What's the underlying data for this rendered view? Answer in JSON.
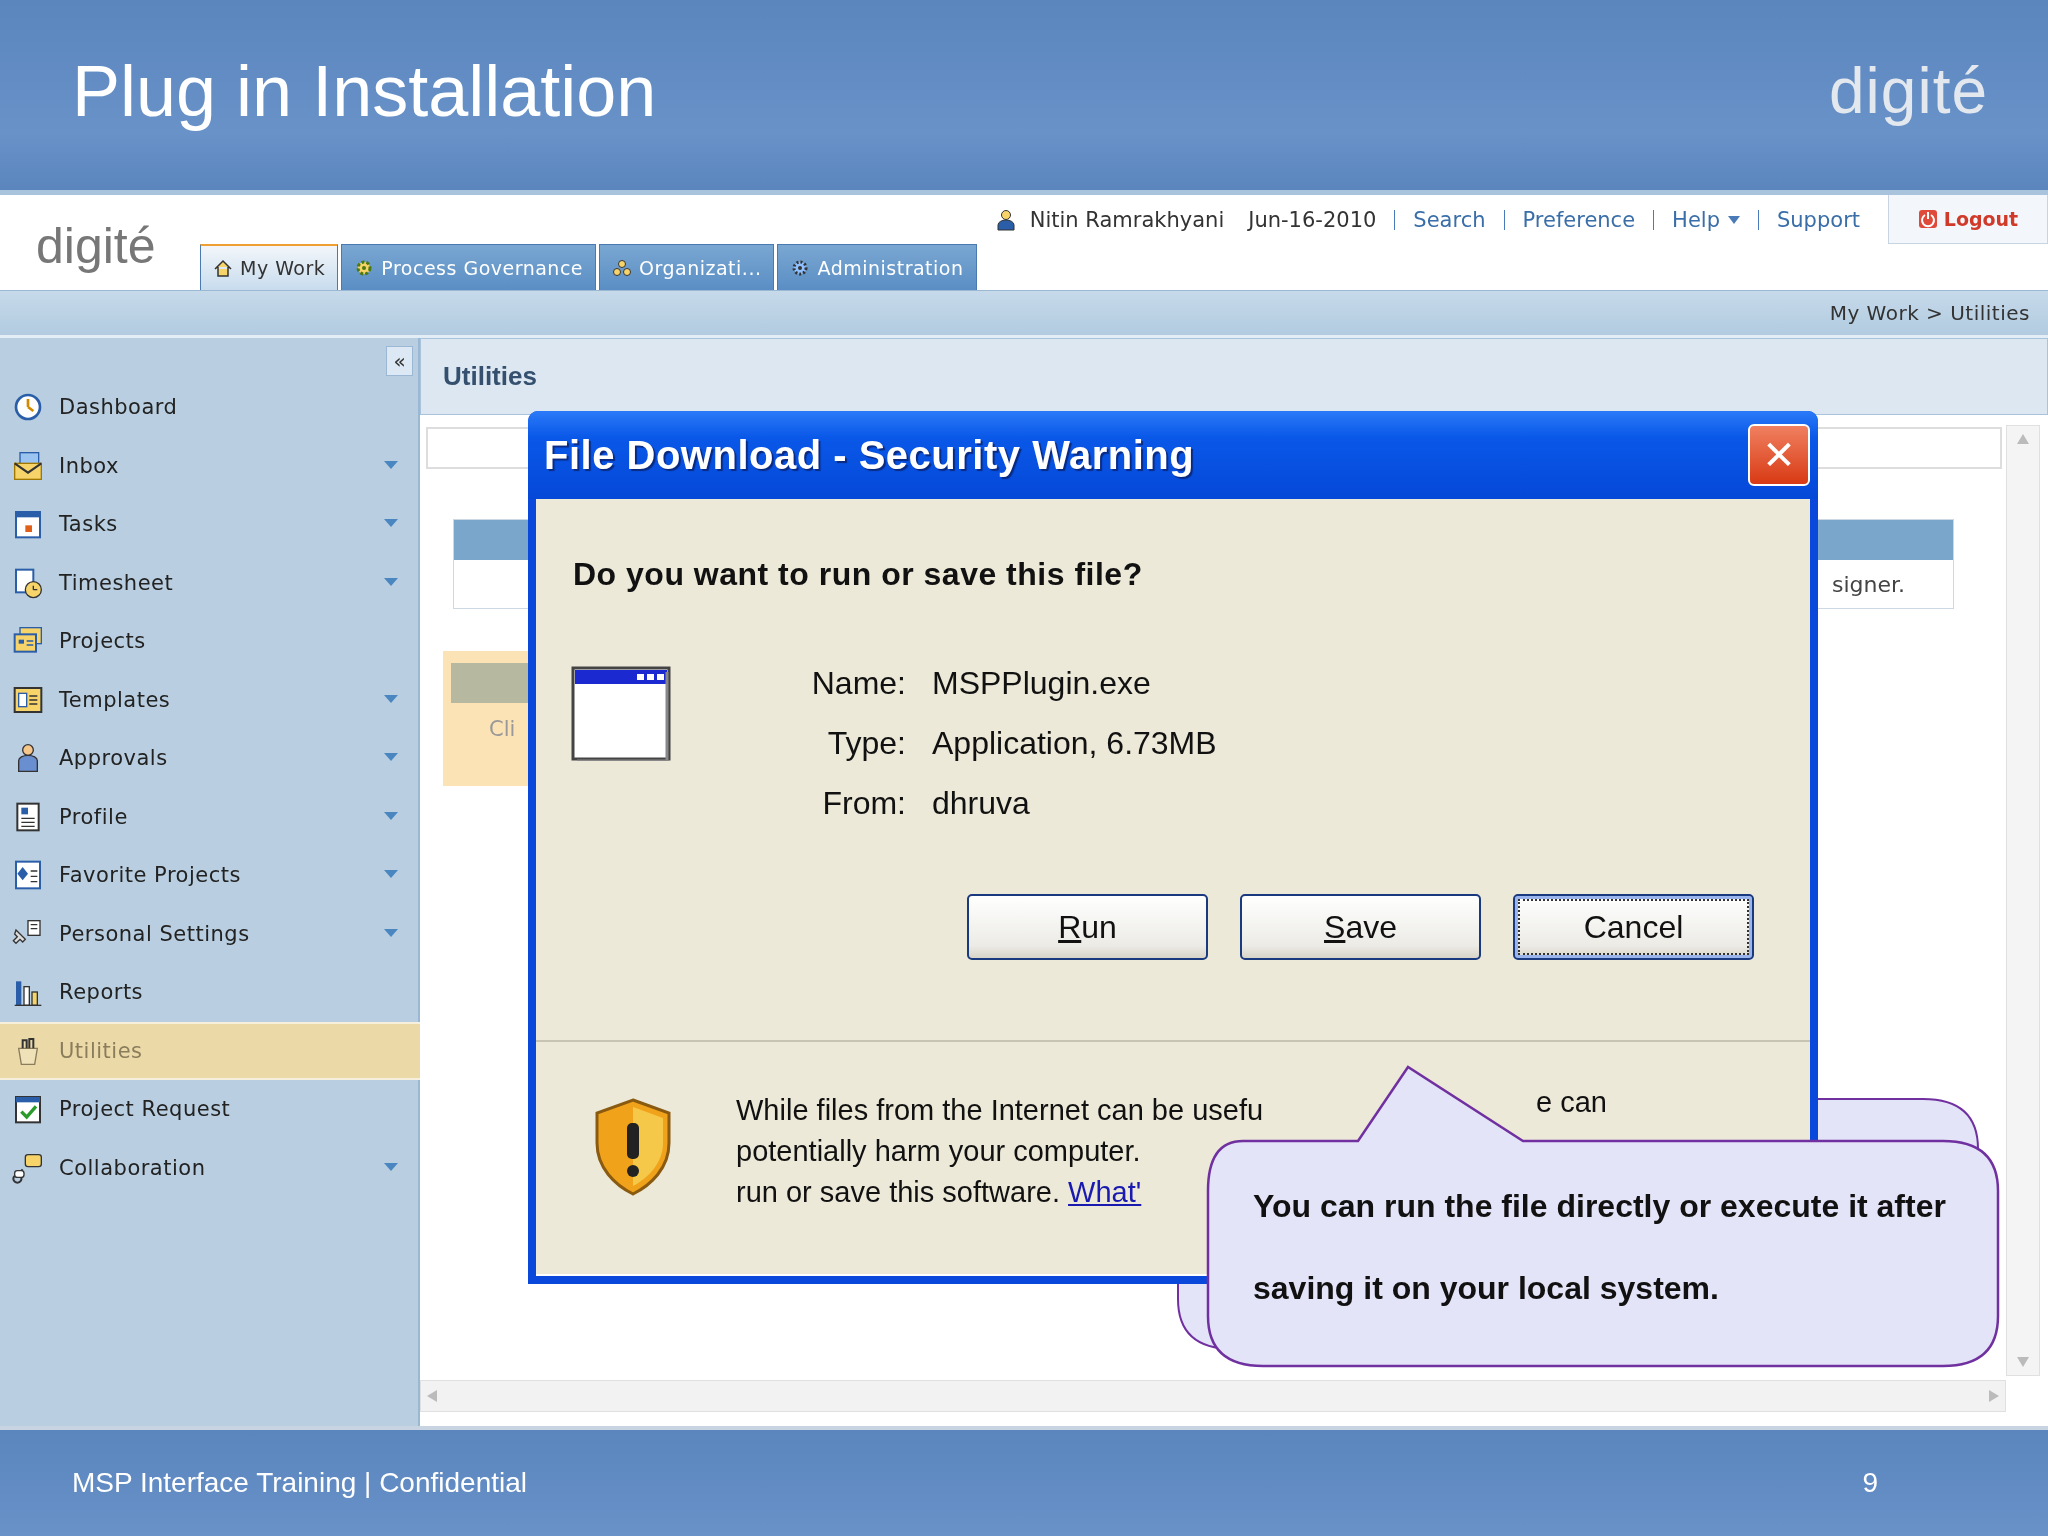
{
  "slide": {
    "title": "Plug in Installation",
    "logo": "digité",
    "footer": "MSP Interface Training | Confidential",
    "page_number": "9"
  },
  "app": {
    "logo": "digité",
    "user": "Nitin Ramrakhyani",
    "date": "Jun-16-2010",
    "links": [
      {
        "label": "Search",
        "has_menu": false
      },
      {
        "label": "Preference",
        "has_menu": false
      },
      {
        "label": "Help",
        "has_menu": true
      },
      {
        "label": "Support",
        "has_menu": false
      }
    ],
    "logout": "Logout",
    "tabs": [
      {
        "label": "My Work",
        "selected": true
      },
      {
        "label": "Process Governance",
        "selected": false
      },
      {
        "label": "Organizati...",
        "selected": false
      },
      {
        "label": "Administration",
        "selected": false
      }
    ],
    "breadcrumb": "My Work > Utilities",
    "collapse": "«",
    "sidebar": [
      {
        "label": "Dashboard",
        "has_menu": false,
        "selected": false
      },
      {
        "label": "Inbox",
        "has_menu": true,
        "selected": false
      },
      {
        "label": "Tasks",
        "has_menu": true,
        "selected": false
      },
      {
        "label": "Timesheet",
        "has_menu": true,
        "selected": false
      },
      {
        "label": "Projects",
        "has_menu": false,
        "selected": false
      },
      {
        "label": "Templates",
        "has_menu": true,
        "selected": false
      },
      {
        "label": "Approvals",
        "has_menu": true,
        "selected": false
      },
      {
        "label": "Profile",
        "has_menu": true,
        "selected": false
      },
      {
        "label": "Favorite Projects",
        "has_menu": true,
        "selected": false
      },
      {
        "label": "Personal Settings",
        "has_menu": true,
        "selected": false
      },
      {
        "label": "Reports",
        "has_menu": false,
        "selected": false
      },
      {
        "label": "Utilities",
        "has_menu": false,
        "selected": true
      },
      {
        "label": "Project Request",
        "has_menu": false,
        "selected": false
      },
      {
        "label": "Collaboration",
        "has_menu": true,
        "selected": false
      }
    ],
    "page_title": "Utilities",
    "table_text": "signer.",
    "card_text": "Cli"
  },
  "dialog": {
    "title": "File Download - Security Warning",
    "close": "✕",
    "question": "Do you want to run or save this file?",
    "fields": [
      {
        "label": "Name:",
        "value": "MSPPlugin.exe"
      },
      {
        "label": "Type:",
        "value": "Application, 6.73MB"
      },
      {
        "label": "From:",
        "value": "dhruva"
      }
    ],
    "buttons": [
      {
        "label": "Run",
        "mnemonic": true,
        "default": false
      },
      {
        "label": "Save",
        "mnemonic": true,
        "default": false
      },
      {
        "label": "Cancel",
        "mnemonic": false,
        "default": true
      }
    ],
    "warning_lines": [
      "While files from the Internet can be usefu",
      "potentially harm your computer.",
      "run or save this software."
    ],
    "warning_fragment": "e can",
    "link": "What'"
  },
  "callout": {
    "text": "You can run the file directly or execute it after saving it on your local system."
  }
}
